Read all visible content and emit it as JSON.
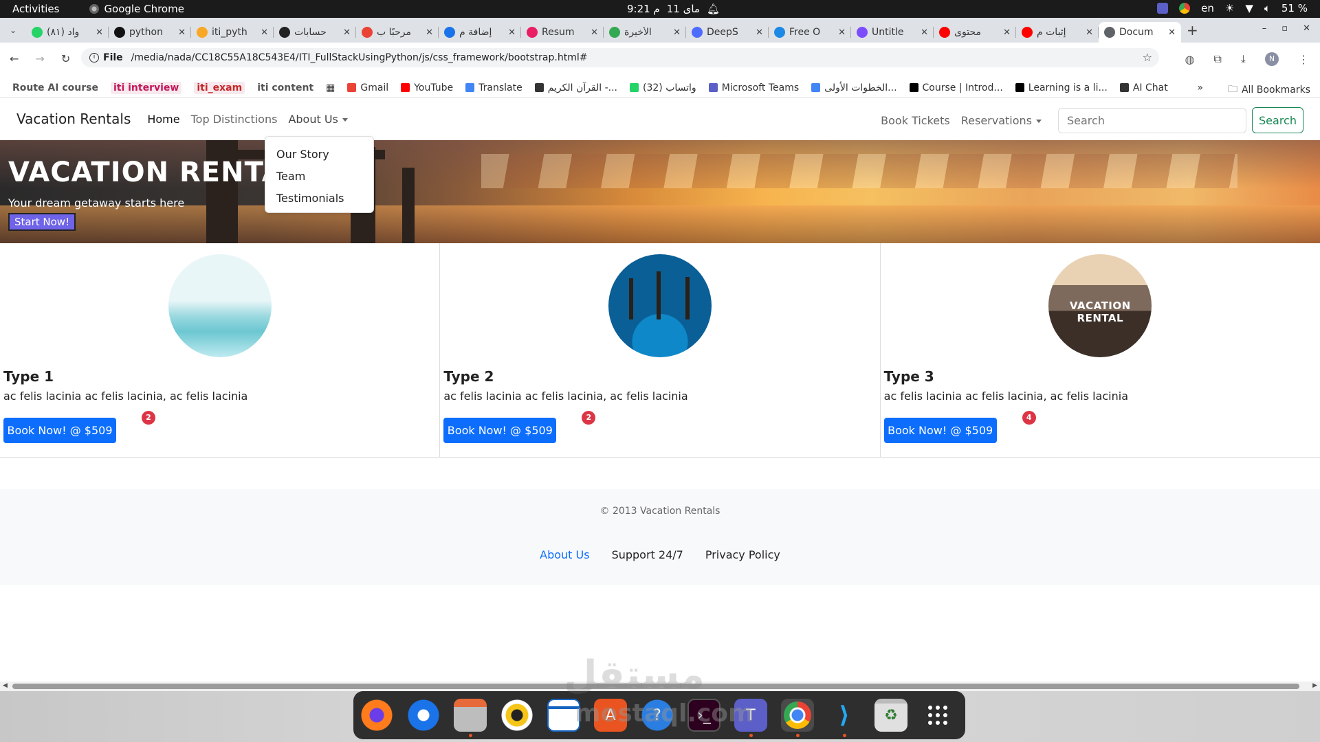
{
  "gnome": {
    "activities": "Activities",
    "app": "Google Chrome",
    "clock": "9:21 م",
    "date": "11 مای",
    "lang": "en",
    "battery": "51 %"
  },
  "tabs": [
    {
      "title": "(٨١) واد",
      "color": "#25d366"
    },
    {
      "title": "python",
      "color": "#111111"
    },
    {
      "title": "iti_pyth",
      "color": "#f9a825"
    },
    {
      "title": "حسابات",
      "color": "#222222"
    },
    {
      "title": "مرحبًا ب",
      "color": "#ea4335"
    },
    {
      "title": "إضافة م",
      "color": "#1a73e8"
    },
    {
      "title": "Resum",
      "color": "#e91e63"
    },
    {
      "title": "الأخيرة",
      "color": "#34a853"
    },
    {
      "title": "DeepS",
      "color": "#4d6bfe"
    },
    {
      "title": "Free O",
      "color": "#1e88e5"
    },
    {
      "title": "Untitle",
      "color": "#7b4dff"
    },
    {
      "title": "محتوى",
      "color": "#ff0000"
    },
    {
      "title": "إثبات م",
      "color": "#ff0000"
    },
    {
      "title": "Docum",
      "color": "#5f6368"
    }
  ],
  "address": {
    "scheme": "File",
    "url": "/media/nada/CC18C55A18C543E4/ITI_FullStackUsingPython/js/css_framework/bootstrap.html#",
    "profile_initial": "N"
  },
  "bookmarks": [
    {
      "label": "Route AI course",
      "style": "plain-bold"
    },
    {
      "label": "iti interview",
      "style": "pill pink"
    },
    {
      "label": "iti_exam",
      "style": "pill red"
    },
    {
      "label": "iti content",
      "style": "plain-bold"
    },
    {
      "label": "",
      "style": "grid"
    },
    {
      "label": "Gmail",
      "style": "icon",
      "color": "#ea4335"
    },
    {
      "label": "YouTube",
      "style": "icon",
      "color": "#ff0000"
    },
    {
      "label": "Translate",
      "style": "icon",
      "color": "#4285f4"
    },
    {
      "label": "القرآن الكريم -...",
      "style": "icon",
      "color": "#333333"
    },
    {
      "label": "واتساب (32)",
      "style": "icon",
      "color": "#25d366"
    },
    {
      "label": "Microsoft Teams",
      "style": "icon",
      "color": "#5b5fc7"
    },
    {
      "label": "الخطوات الأولى...",
      "style": "icon",
      "color": "#4285f4"
    },
    {
      "label": "Course | Introd...",
      "style": "icon",
      "color": "#000000"
    },
    {
      "label": "Learning is a li...",
      "style": "icon",
      "color": "#000000"
    },
    {
      "label": "AI Chat",
      "style": "icon",
      "color": "#333333"
    }
  ],
  "all_bookmarks": "All Bookmarks",
  "navbar": {
    "brand": "Vacation Rentals",
    "home": "Home",
    "top": "Top Distinctions",
    "about": "About Us",
    "tickets": "Book Tickets",
    "reservations": "Reservations",
    "search_placeholder": "Search",
    "search_button": "Search"
  },
  "dropdown": [
    "Our Story",
    "Team",
    "Testimonials"
  ],
  "hero": {
    "title": "VACATION RENTALS",
    "subtitle": "Your dream getaway starts here",
    "button": "Start Now!"
  },
  "cards": [
    {
      "title": "Type 1",
      "text": "ac felis lacinia ac felis lacinia, ac felis lacinia",
      "button": "Book Now! @ $509",
      "badge": "2"
    },
    {
      "title": "Type 2",
      "text": "ac felis lacinia ac felis lacinia, ac felis lacinia",
      "button": "Book Now! @ $509",
      "badge": "2"
    },
    {
      "title": "Type 3",
      "text": "ac felis lacinia ac felis lacinia, ac felis lacinia",
      "button": "Book Now! @ $509",
      "badge": "4",
      "image_text": "VACATION RENTAL"
    }
  ],
  "footer": {
    "copyright": "© 2013 Vacation Rentals",
    "links": [
      "About Us",
      "Support 24/7",
      "Privacy Policy"
    ]
  },
  "watermark": "مستقل",
  "watermark_sub": "mostaql.com"
}
